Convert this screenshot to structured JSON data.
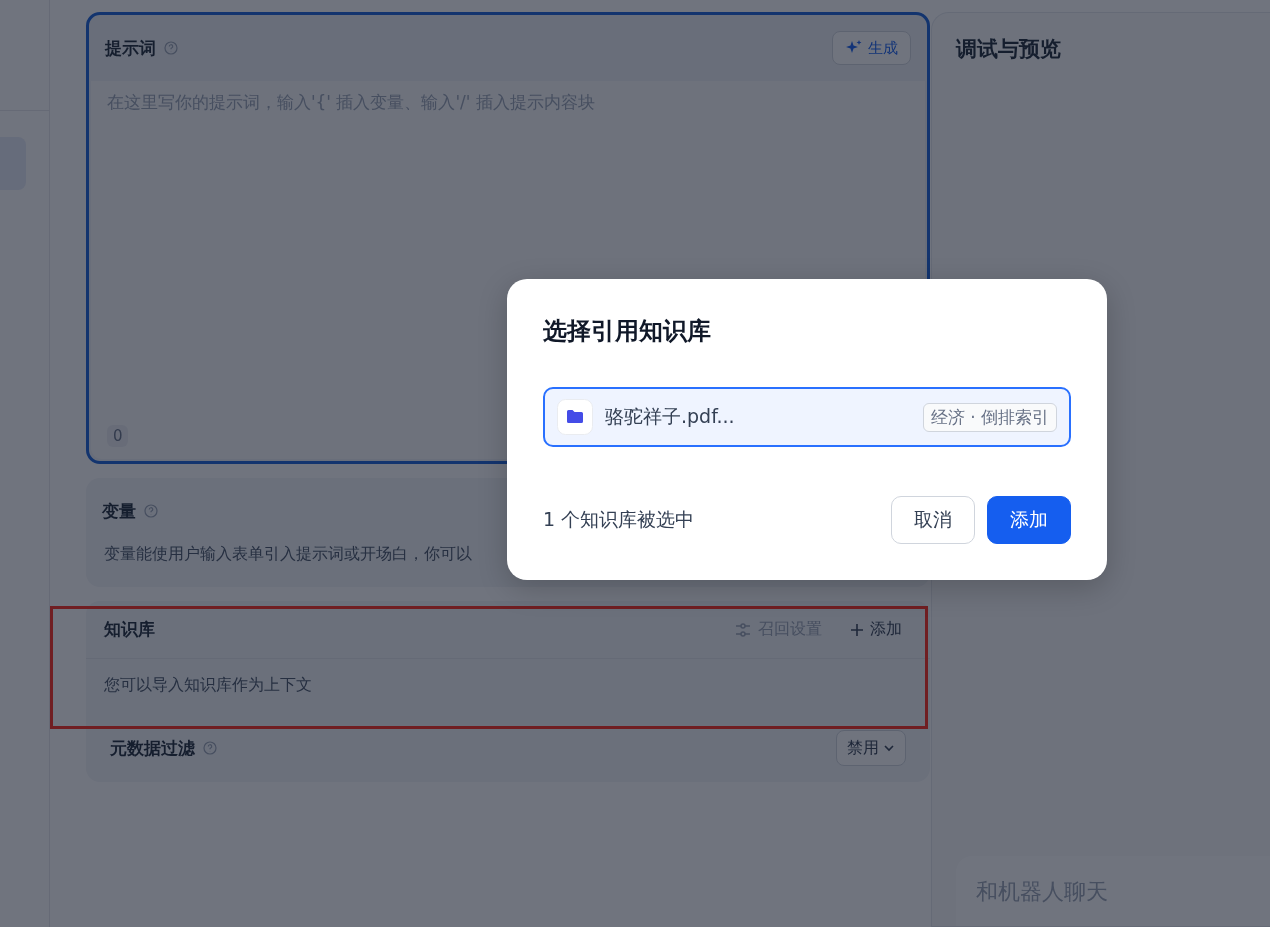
{
  "prompt": {
    "title": "提示词",
    "generate_button": "生成",
    "placeholder": "在这里写你的提示词，输入'{' 插入变量、输入'/' 插入提示内容块",
    "char_count": "0"
  },
  "variables": {
    "title": "变量",
    "description": "变量能使用户输入表单引入提示词或开场白，你可以"
  },
  "knowledge": {
    "title": "知识库",
    "recall_settings": {
      "label": "召回设置",
      "disabled": true
    },
    "add_button": "添加",
    "description": "您可以导入知识库作为上下文",
    "highlighted": true
  },
  "metadata_filter": {
    "title": "元数据过滤",
    "dropdown": "禁用"
  },
  "preview": {
    "title": "调试与预览",
    "chat_placeholder": "和机器人聊天"
  },
  "dialog": {
    "title": "选择引用知识库",
    "datasets": [
      {
        "name": "骆驼祥子.pdf...",
        "tag": "经济 · 倒排索引",
        "selected": true
      }
    ],
    "selection_count": "1 个知识库被选中",
    "buttons": {
      "cancel": "取消",
      "confirm": "添加"
    }
  }
}
